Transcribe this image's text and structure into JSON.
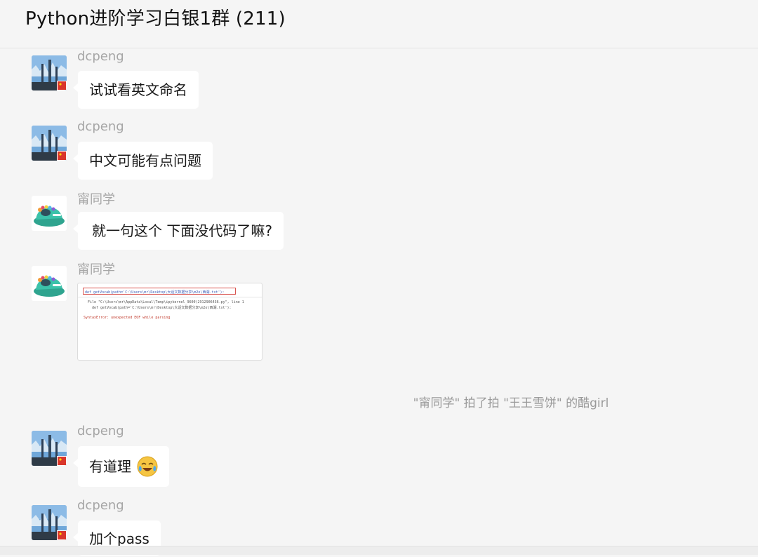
{
  "header": {
    "title": "Python进阶学习白银1群 (211)"
  },
  "messages": [
    {
      "sender": "dcpeng",
      "text": "试试看英文命名",
      "avatar": "city-avatar"
    },
    {
      "sender": "dcpeng",
      "text": "中文可能有点问题",
      "avatar": "city-avatar"
    },
    {
      "sender": "甯同学",
      "text": "就一句这个 下面没代码了嘛?",
      "avatar": "shoe-avatar"
    },
    {
      "sender": "甯同学",
      "avatar": "shoe-avatar",
      "image": {
        "line1": "def getVocab(path='C:\\Users\\mr\\Desktop\\大话文数据分享\\m2o\\西湖.txt'):",
        "line2": "File \"C:\\Users\\mr\\AppData\\Local\\Temp\\ipykernel_9600\\2912906436.py\", line 1",
        "line3": "def getVocab(path='C:\\Users\\mr\\Desktop\\大话文数据分享\\m2o\\西湖.txt'):",
        "line4": "SyntaxError: unexpected EOF while parsing"
      }
    },
    {
      "sender": "dcpeng",
      "text": "有道理",
      "emoji": "crying-laughing-emoji",
      "avatar": "city-avatar"
    },
    {
      "sender": "dcpeng",
      "text": "加个pass",
      "avatar": "city-avatar"
    }
  ],
  "notice": "\"甯同学\" 拍了拍 \"王王雪饼\" 的酷girl",
  "colors": {
    "bg": "#f5f5f5",
    "bubble": "#ffffff",
    "sender": "#a6a6a6",
    "emoji": "#f5c542",
    "error": "#d9534f"
  }
}
